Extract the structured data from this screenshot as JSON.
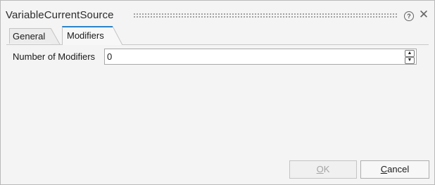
{
  "dialog": {
    "title": "VariableCurrentSource",
    "help_icon": "help-circle-icon",
    "close_icon": "close-icon",
    "tabs": [
      {
        "label": "General",
        "selected": false
      },
      {
        "label": "Modifiers",
        "selected": true
      }
    ],
    "field": {
      "label": "Number of Modifiers",
      "value": "0"
    },
    "buttons": {
      "ok": {
        "mnemonic": "O",
        "rest": "K",
        "enabled": false
      },
      "cancel": {
        "mnemonic": "C",
        "rest": "ancel",
        "enabled": true
      }
    },
    "colors": {
      "active_tab_accent": "#2a82c8",
      "dialog_background": "#f4f4f4"
    }
  }
}
